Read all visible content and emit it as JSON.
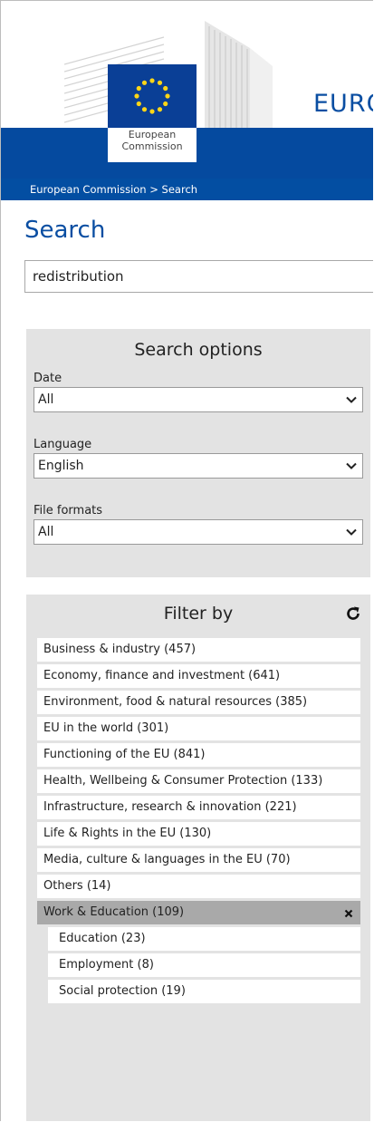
{
  "header": {
    "logo_text": "European\nCommission",
    "site_title": "EURO",
    "brand_color": "#054a9f"
  },
  "breadcrumb": "European Commission > Search",
  "page_title": "Search",
  "search": {
    "value": "redistribution"
  },
  "search_options": {
    "title": "Search options",
    "fields": [
      {
        "label": "Date",
        "value": "All"
      },
      {
        "label": "Language",
        "value": "English"
      },
      {
        "label": "File formats",
        "value": "All"
      }
    ]
  },
  "filter": {
    "title": "Filter by",
    "items": [
      "Business & industry (457)",
      "Economy, finance and investment (641)",
      "Environment, food & natural resources (385)",
      "EU in the world (301)",
      "Functioning of the EU (841)",
      "Health, Wellbeing & Consumer Protection (133)",
      "Infrastructure, research & innovation (221)",
      "Life & Rights in the EU (130)",
      "Media, culture & languages in the EU (70)",
      "Others (14)"
    ],
    "active": "Work & Education (109)",
    "sub_items": [
      "Education (23)",
      "Employment (8)",
      "Social protection (19)"
    ]
  },
  "icons": {
    "refresh": "refresh-icon",
    "remove": "close-icon",
    "dropdown": "chevron-down-icon"
  }
}
